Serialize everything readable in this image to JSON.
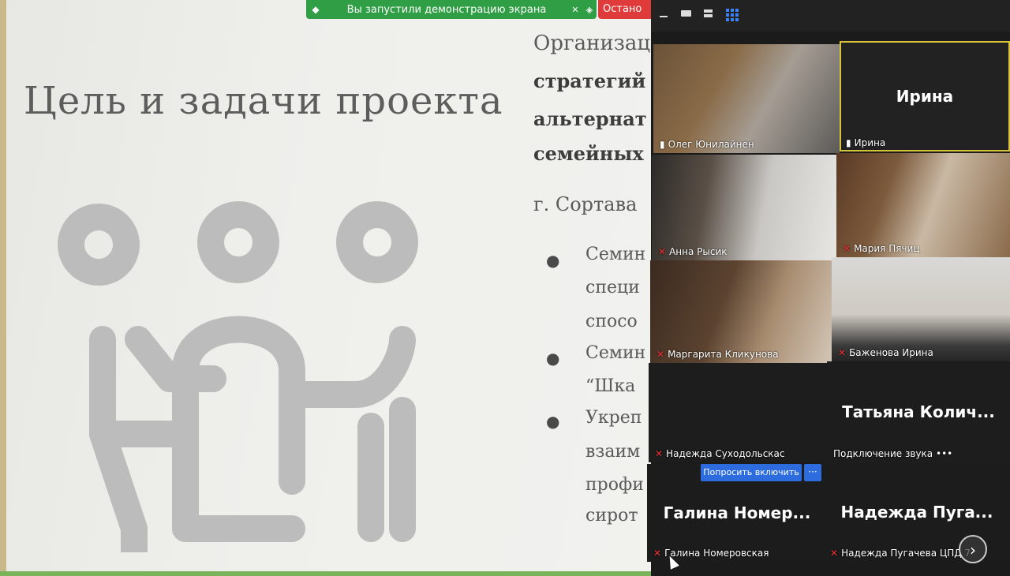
{
  "slide": {
    "title": "Цель и задачи проекта",
    "text_line1": "Организац",
    "text_line2": "стратегий",
    "text_line3": "альтернат",
    "text_line4": "семейных",
    "city_line": "г. Сортава",
    "bullets": [
      {
        "lines": [
          "Семин",
          "специ",
          "спосо"
        ]
      },
      {
        "lines": [
          "Семин",
          "“Шка"
        ]
      },
      {
        "lines": [
          "Укреп",
          "взаим",
          "профи",
          "сирот"
        ]
      }
    ],
    "bullet_glyph": "●"
  },
  "share_banner": {
    "label": "Вы запустили демонстрацию экрана",
    "stop_label": "Остано",
    "color": "#2f9e44"
  },
  "zoom": {
    "participants": [
      {
        "name": "Олег Юнилайнен",
        "pinned": true,
        "muted": false
      },
      {
        "name": "Ирина",
        "display": "Ирина",
        "pinned": true,
        "muted": false,
        "active_speaker": true
      },
      {
        "name": "Анна Рысик",
        "muted": true
      },
      {
        "name": "Мария Пячиц",
        "muted": true
      },
      {
        "name": "Маргарита Кликунова",
        "muted": true
      },
      {
        "name": "Баженова Ирина",
        "muted": true
      },
      {
        "name": "Надежда Суходольскас",
        "muted": true
      },
      {
        "name": "Подключение звука",
        "display": "Татьяна Колич...",
        "suffix": "•••"
      },
      {
        "name": "Галина Номеровская",
        "display": "Галина Номер...",
        "muted": true
      },
      {
        "name": "Надежда Пугачева ЦПД 7",
        "display": "Надежда Пуга...",
        "muted": true
      }
    ],
    "request_button": "Попросить включить",
    "more_button": "···",
    "next_icon": "›",
    "mic_icon": "🎤",
    "pin_icon": "📌"
  }
}
